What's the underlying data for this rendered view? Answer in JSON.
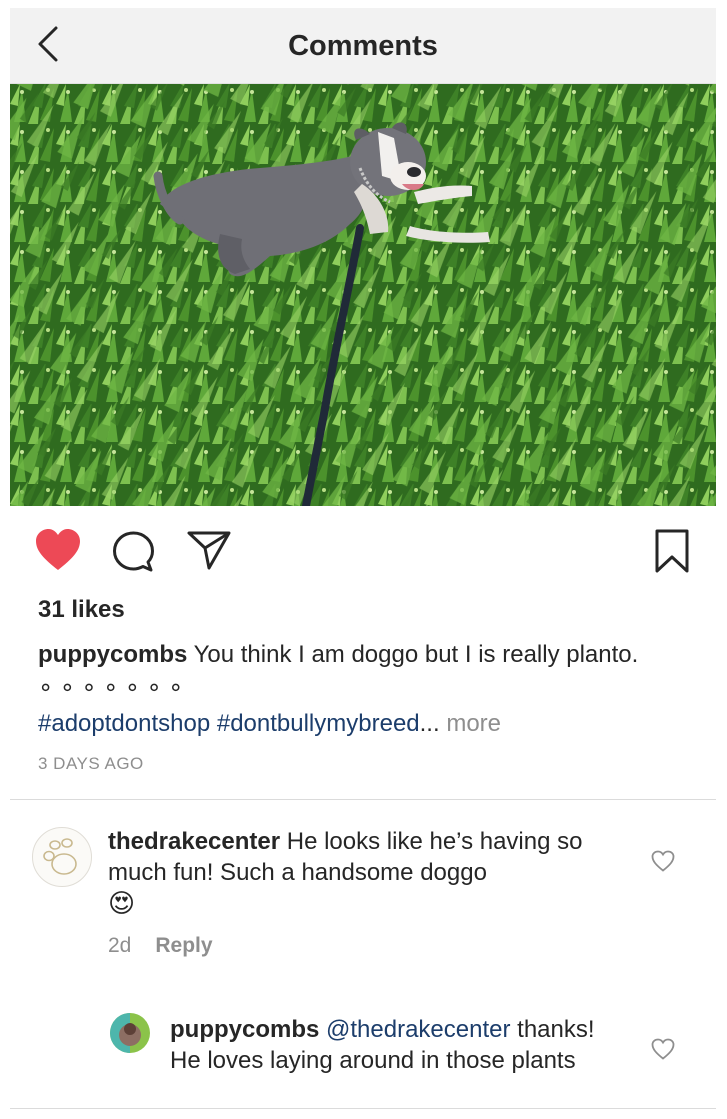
{
  "header": {
    "title": "Comments",
    "back_icon": "chevron-left-icon"
  },
  "post": {
    "image_alt": "Gray pit bull lying in green ice plants on a leash",
    "actions": {
      "like_icon": "heart-filled-icon",
      "comment_icon": "comment-icon",
      "share_icon": "paper-plane-icon",
      "save_icon": "bookmark-icon",
      "like_color": "#ed4956"
    },
    "likes": "31 likes",
    "caption": {
      "username": "puppycombs",
      "text": " You think I am doggo but I is really planto. ∘ ∘ ∘ ∘ ∘ ∘ ∘"
    },
    "hashtags": [
      "#adoptdontshop",
      "#dontbullymybreed"
    ],
    "ellipsis": "...",
    "more_label": "more",
    "time_ago": "3 DAYS AGO"
  },
  "comments": [
    {
      "username": "thedrakecenter",
      "text": " He looks like he’s having so much fun! Such a handsome doggo",
      "emoji": "😍",
      "age": "2d",
      "reply_label": "Reply"
    }
  ],
  "replies": [
    {
      "username": "puppycombs",
      "mention": "@thedrakecenter",
      "text": "thanks! He loves laying around in those plants"
    }
  ],
  "colors": {
    "link": "#1c3d6b",
    "muted": "#8e8e8e",
    "header_bg": "#f2f2f2"
  }
}
